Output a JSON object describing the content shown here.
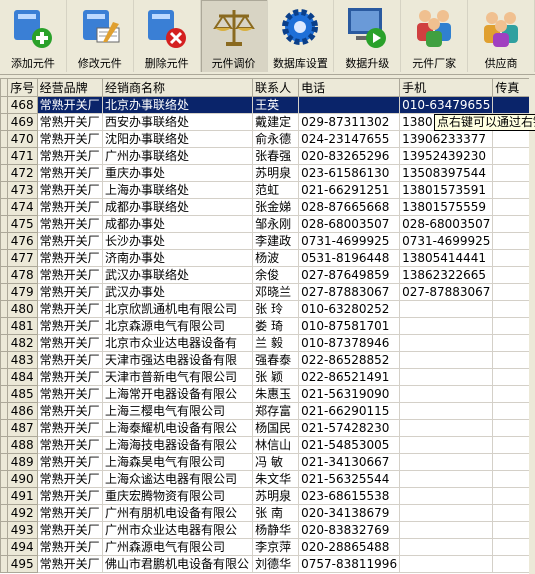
{
  "toolbar": {
    "buttons": [
      {
        "label": "添加元件",
        "icon": "add-icon"
      },
      {
        "label": "修改元件",
        "icon": "edit-icon"
      },
      {
        "label": "删除元件",
        "icon": "delete-icon"
      },
      {
        "label": "元件调价",
        "icon": "scale-icon"
      },
      {
        "label": "数据库设置",
        "icon": "gear-icon"
      },
      {
        "label": "数据升级",
        "icon": "upgrade-icon"
      },
      {
        "label": "元件厂家",
        "icon": "people-icon"
      },
      {
        "label": "供应商",
        "icon": "group-icon"
      }
    ]
  },
  "table": {
    "columns": [
      "序号",
      "经营品牌",
      "经销商名称",
      "联系人",
      "电话",
      "手机",
      "传真"
    ],
    "rows": [
      [
        "468",
        "常熟开关厂",
        "北京办事联络处",
        "王英",
        "",
        "010-63479655",
        ""
      ],
      [
        "469",
        "常熟开关厂",
        "西安办事联络处",
        "戴建定",
        "029-87311302",
        "13801575",
        ""
      ],
      [
        "470",
        "常熟开关厂",
        "沈阳办事联络处",
        "俞永德",
        "024-23147655",
        "13906233377",
        ""
      ],
      [
        "471",
        "常熟开关厂",
        "广州办事联络处",
        "张春强",
        "020-83265296",
        "13952439230",
        ""
      ],
      [
        "472",
        "常熟开关厂",
        "重庆办事处",
        "苏明泉",
        "023-61586130",
        "13508397544",
        ""
      ],
      [
        "473",
        "常熟开关厂",
        "上海办事联络处",
        "范虹",
        "021-66291251",
        "13801573591",
        ""
      ],
      [
        "474",
        "常熟开关厂",
        "成都办事联络处",
        "张金娣",
        "028-87665668",
        "13801575559",
        ""
      ],
      [
        "475",
        "常熟开关厂",
        "成都办事处",
        "邹永刚",
        "028-68003507",
        "028-68003507",
        ""
      ],
      [
        "476",
        "常熟开关厂",
        "长沙办事处",
        "李建政",
        "0731-4699925",
        "0731-4699925",
        ""
      ],
      [
        "477",
        "常熟开关厂",
        "济南办事处",
        "杨波",
        "0531-8196448",
        "13805414441",
        ""
      ],
      [
        "478",
        "常熟开关厂",
        "武汉办事联络处",
        "余俊",
        "027-87649859",
        "13862322665",
        ""
      ],
      [
        "479",
        "常熟开关厂",
        "武汉办事处",
        "邓晓兰",
        "027-87883067",
        "027-87883067",
        ""
      ],
      [
        "480",
        "常熟开关厂",
        "北京欣凯通机电有限公司",
        "张 玲",
        "010-63280252",
        "",
        ""
      ],
      [
        "481",
        "常熟开关厂",
        "北京森源电气有限公司",
        "娄 琦",
        "010-87581701",
        "",
        ""
      ],
      [
        "482",
        "常熟开关厂",
        "北京市众业达电器设备有",
        "兰 毅",
        "010-87378946",
        "",
        ""
      ],
      [
        "483",
        "常熟开关厂",
        "天津市强达电器设备有限",
        "强春泰",
        "022-86528852",
        "",
        ""
      ],
      [
        "484",
        "常熟开关厂",
        "天津市普新电气有限公司",
        "张 颖",
        "022-86521491",
        "",
        ""
      ],
      [
        "485",
        "常熟开关厂",
        "上海常开电器设备有限公",
        "朱惠玉",
        "021-56319090",
        "",
        ""
      ],
      [
        "486",
        "常熟开关厂",
        "上海三樱电气有限公司",
        "郑存富",
        "021-66290115",
        "",
        ""
      ],
      [
        "487",
        "常熟开关厂",
        "上海泰耀机电设备有限公",
        "杨国民",
        "021-57428230",
        "",
        ""
      ],
      [
        "488",
        "常熟开关厂",
        "上海海技电器设备有限公",
        "林信山",
        "021-54853005",
        "",
        ""
      ],
      [
        "489",
        "常熟开关厂",
        "上海森昊电气有限公司",
        "冯 敏",
        "021-34130667",
        "",
        ""
      ],
      [
        "490",
        "常熟开关厂",
        "上海众谧达电器有限公司",
        "朱文华",
        "021-56325544",
        "",
        ""
      ],
      [
        "491",
        "常熟开关厂",
        "重庆宏腾物资有限公司",
        "苏明泉",
        "023-68615538",
        "",
        ""
      ],
      [
        "492",
        "常熟开关厂",
        "广州有朋机电设备有限公",
        "张 南",
        "020-34138679",
        "",
        ""
      ],
      [
        "493",
        "常熟开关厂",
        "广州市众业达电器有限公",
        "杨静华",
        "020-83832769",
        "",
        ""
      ],
      [
        "494",
        "常熟开关厂",
        "广州森源电气有限公司",
        "李京萍",
        "020-28865488",
        "",
        ""
      ],
      [
        "495",
        "常熟开关厂",
        "佛山市君鹏机电设备有限公",
        "刘德华",
        "0757-83811996",
        "",
        ""
      ]
    ],
    "selected_index": 0
  },
  "tooltip": {
    "text": "点右键可以通过右键"
  },
  "colors": {
    "selection": "#0a246a",
    "tooltip_bg": "#ffffe1",
    "window_bg": "#ece9d8"
  }
}
